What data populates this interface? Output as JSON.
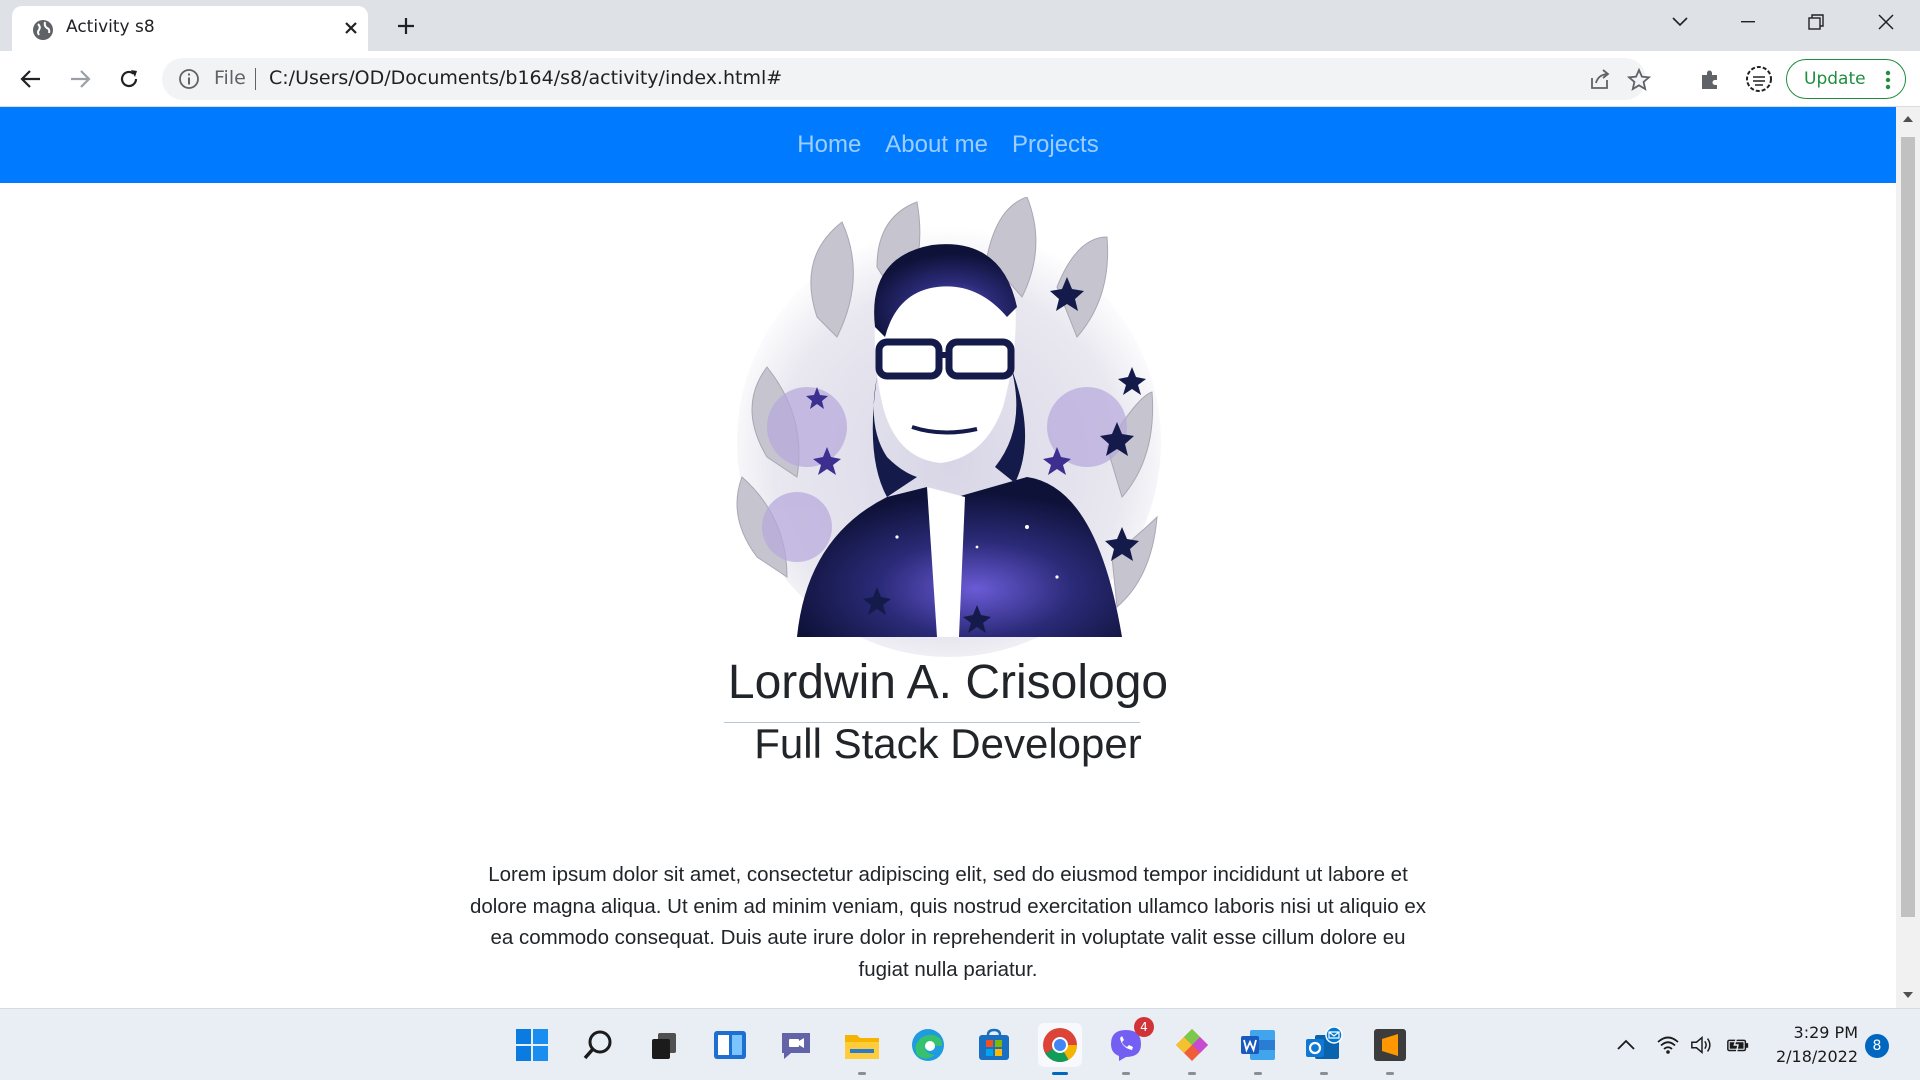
{
  "browser": {
    "tab_title": "Activity s8",
    "address_scheme_label": "File",
    "address_url": "C:/Users/OD/Documents/b164/s8/activity/index.html#",
    "update_label": "Update"
  },
  "page": {
    "nav_links": [
      "Home",
      "About me",
      "Projects"
    ],
    "name": "Lordwin A. Crisologo",
    "role": "Full Stack Developer",
    "paragraph": "Lorem ipsum dolor sit amet, consectetur adipiscing elit, sed do eiusmod tempor incididunt ut labore et dolore magna aliqua. Ut enim ad minim veniam, quis nostrud exercitation ullamco laboris nisi ut aliquio ex ea commodo consequat. Duis aute irure dolor in reprehenderit in voluptate valit esse cillum dolore eu fugiat nulla pariatur.",
    "navbar_color": "#007bff"
  },
  "taskbar": {
    "apps": [
      "start",
      "search",
      "task-view",
      "widgets",
      "teams-chat",
      "file-explorer",
      "edge",
      "microsoft-store",
      "chrome",
      "viber",
      "git-client",
      "word",
      "outlook",
      "sublime-text"
    ],
    "viber_badge": "4",
    "time": "3:29 PM",
    "date": "2/18/2022",
    "notification_count": "8"
  }
}
